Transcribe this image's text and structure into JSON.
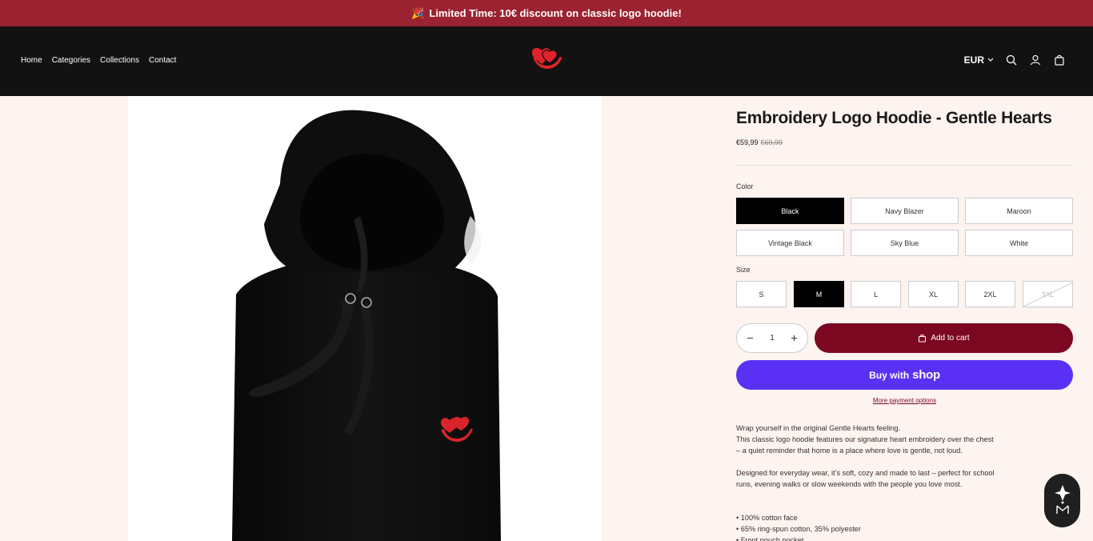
{
  "announcement": {
    "emoji": "🎉",
    "text": "Limited Time: 10€ discount on classic logo hoodie!"
  },
  "nav": {
    "items": [
      "Home",
      "Categories",
      "Collections",
      "Contact"
    ]
  },
  "header": {
    "currency": "EUR",
    "icons": [
      "search-icon",
      "account-icon",
      "cart-icon"
    ]
  },
  "brand": {
    "logo_color": "#e0232a",
    "bar_color": "#9b2230"
  },
  "product": {
    "title": "Embroidery Logo Hoodie - Gentle Hearts",
    "price": "€59,99",
    "compare_price": "€69,99",
    "color_label": "Color",
    "colors": [
      "Black",
      "Navy Blazer",
      "Maroon",
      "Vintage Black",
      "Sky Blue",
      "White"
    ],
    "selected_color": "Black",
    "size_label": "Size",
    "sizes": [
      "S",
      "M",
      "L",
      "XL",
      "2XL",
      "3XL"
    ],
    "selected_size": "M",
    "unavailable_size": "3XL",
    "quantity": "1",
    "add_to_cart": "Add to cart",
    "buy_with": "Buy with",
    "shop": "shop",
    "more_payment": "More payment options",
    "description": [
      "Wrap yourself in the original Gentle Hearts feeling.",
      "This classic logo hoodie features our signature heart embroidery over the chest",
      "– a quiet reminder that home is a place where love is gentle, not loud.",
      "Designed for everyday wear, it’s soft, cozy and made to last – perfect for school",
      "runs, evening walks or slow weekends with the people you love most.",
      "• 100% cotton face",
      "• 65% ring-spun cotton, 35% polyester",
      "• Front pouch pocket"
    ],
    "accent_color": "#7c0721",
    "shop_pay_color": "#5a31f4"
  }
}
